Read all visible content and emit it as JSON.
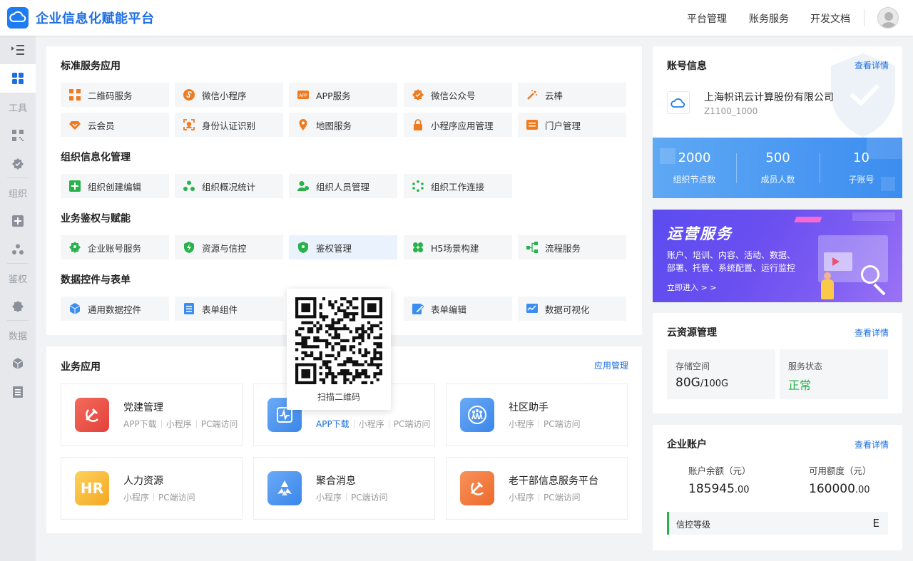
{
  "header": {
    "app_title": "企业信息化赋能平台",
    "nav": [
      "平台管理",
      "账务服务",
      "开发文档"
    ]
  },
  "sidebar": {
    "labels": [
      "工具",
      "组织",
      "鉴权",
      "数据"
    ]
  },
  "standard_services": {
    "title": "标准服务应用",
    "items": [
      "二维码服务",
      "微信小程序",
      "APP服务",
      "微信公众号",
      "云棒",
      "云会员",
      "身份认证识别",
      "地图服务",
      "小程序应用管理",
      "门户管理"
    ]
  },
  "org_mgmt": {
    "title": "组织信息化管理",
    "items": [
      "组织创建编辑",
      "组织概况统计",
      "组织人员管理",
      "组织工作连接"
    ]
  },
  "auth": {
    "title": "业务鉴权与赋能",
    "items": [
      "企业账号服务",
      "资源与信控",
      "鉴权管理",
      "H5场景构建",
      "流程服务"
    ]
  },
  "data_ctrl": {
    "title": "数据控件与表单",
    "items": [
      "通用数据控件",
      "表单组件",
      "表单编辑",
      "数据可视化"
    ]
  },
  "qr_popup": {
    "label": "扫描二维码"
  },
  "biz_apps": {
    "title": "业务应用",
    "manage_link": "应用管理",
    "apps": [
      {
        "name": "党建管理",
        "links": [
          "APP下载",
          "小程序",
          "PC端访问"
        ]
      },
      {
        "name": "",
        "links": [
          "APP下载",
          "小程序",
          "PC端访问"
        ]
      },
      {
        "name": "社区助手",
        "links": [
          "小程序",
          "PC端访问"
        ]
      },
      {
        "name": "人力资源",
        "icon_text": "HR",
        "links": [
          "小程序",
          "PC端访问"
        ]
      },
      {
        "name": "聚合消息",
        "links": [
          "小程序",
          "PC端访问"
        ]
      },
      {
        "name": "老干部信息服务平台",
        "links": [
          "小程序",
          "PC端访问"
        ]
      }
    ]
  },
  "account": {
    "title": "账号信息",
    "detail_link": "查看详情",
    "company": "上海帜讯云计算股份有限公司",
    "code": "Z1100_1000",
    "stats": [
      {
        "value": "2000",
        "label": "组织节点数"
      },
      {
        "value": "500",
        "label": "成员人数"
      },
      {
        "value": "10",
        "label": "子账号"
      }
    ]
  },
  "banner": {
    "title": "运营服务",
    "desc_line1": "账户、培训、内容、活动、数据、",
    "desc_line2": "部署、托管、系统配置、运行监控",
    "cta": "立即进入 > >"
  },
  "cloud": {
    "title": "云资源管理",
    "detail_link": "查看详情",
    "storage_label": "存储空间",
    "storage_used": "80G",
    "storage_total": "/100G",
    "status_label": "服务状态",
    "status_value": "正常"
  },
  "enterprise_account": {
    "title": "企业账户",
    "detail_link": "查看详情",
    "balance_label": "账户余额（元）",
    "balance_int": "185945",
    "balance_dec": ".00",
    "credit_label": "可用额度（元）",
    "credit_int": "160000",
    "credit_dec": ".00",
    "level_label": "信控等级",
    "level_value": "E"
  },
  "colors": {
    "primary": "#1e6fe0",
    "orange": "#f07a1e",
    "green": "#27b24a",
    "red": "#e8483a"
  }
}
